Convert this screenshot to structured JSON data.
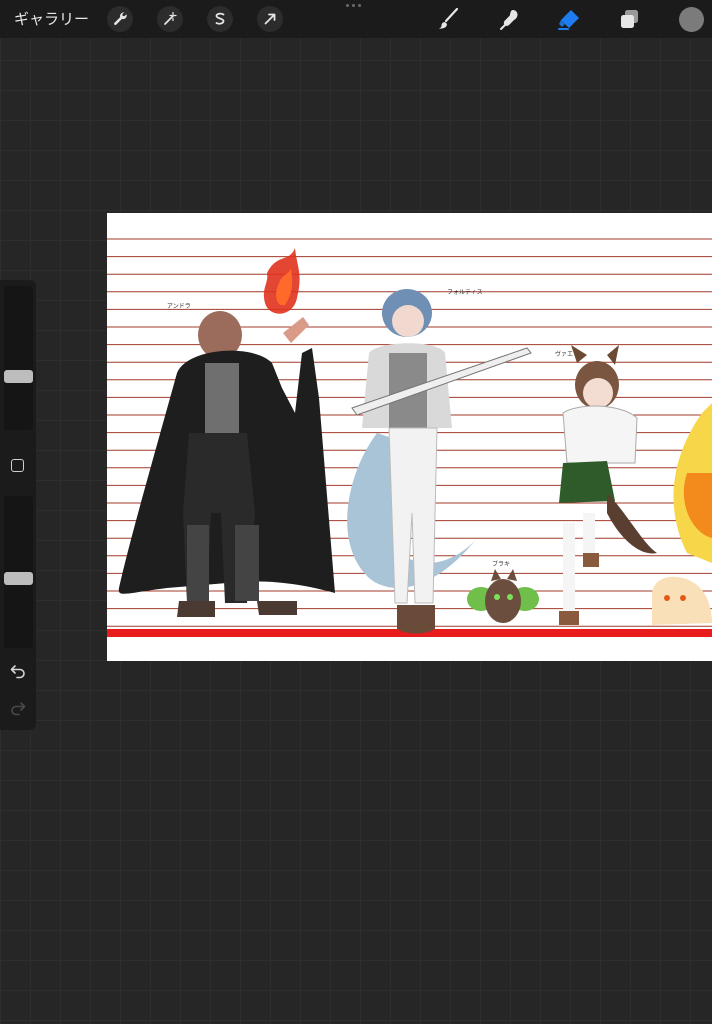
{
  "app": {
    "gallery_label": "ギャラリー",
    "left_tools": [
      "wrench-icon",
      "magic-wand-icon",
      "selection-icon",
      "transform-arrow-icon"
    ],
    "right_tools": [
      "brush-icon",
      "smudge-icon",
      "eraser-icon",
      "layers-icon"
    ],
    "active_tool": "eraser-icon",
    "accent_color": "#1e7cf0",
    "current_color": "#7b7b7b"
  },
  "sidebar": {
    "brush_size_level": 0.36,
    "opacity_level": 0.45
  },
  "canvas": {
    "background": "#ffffff",
    "guide_line_color": "#a33a2a",
    "base_line_color": "#e81c1c",
    "character_labels": [
      "アンドラ",
      "フォルティス",
      "ヴァエ",
      "ブラキ"
    ]
  }
}
